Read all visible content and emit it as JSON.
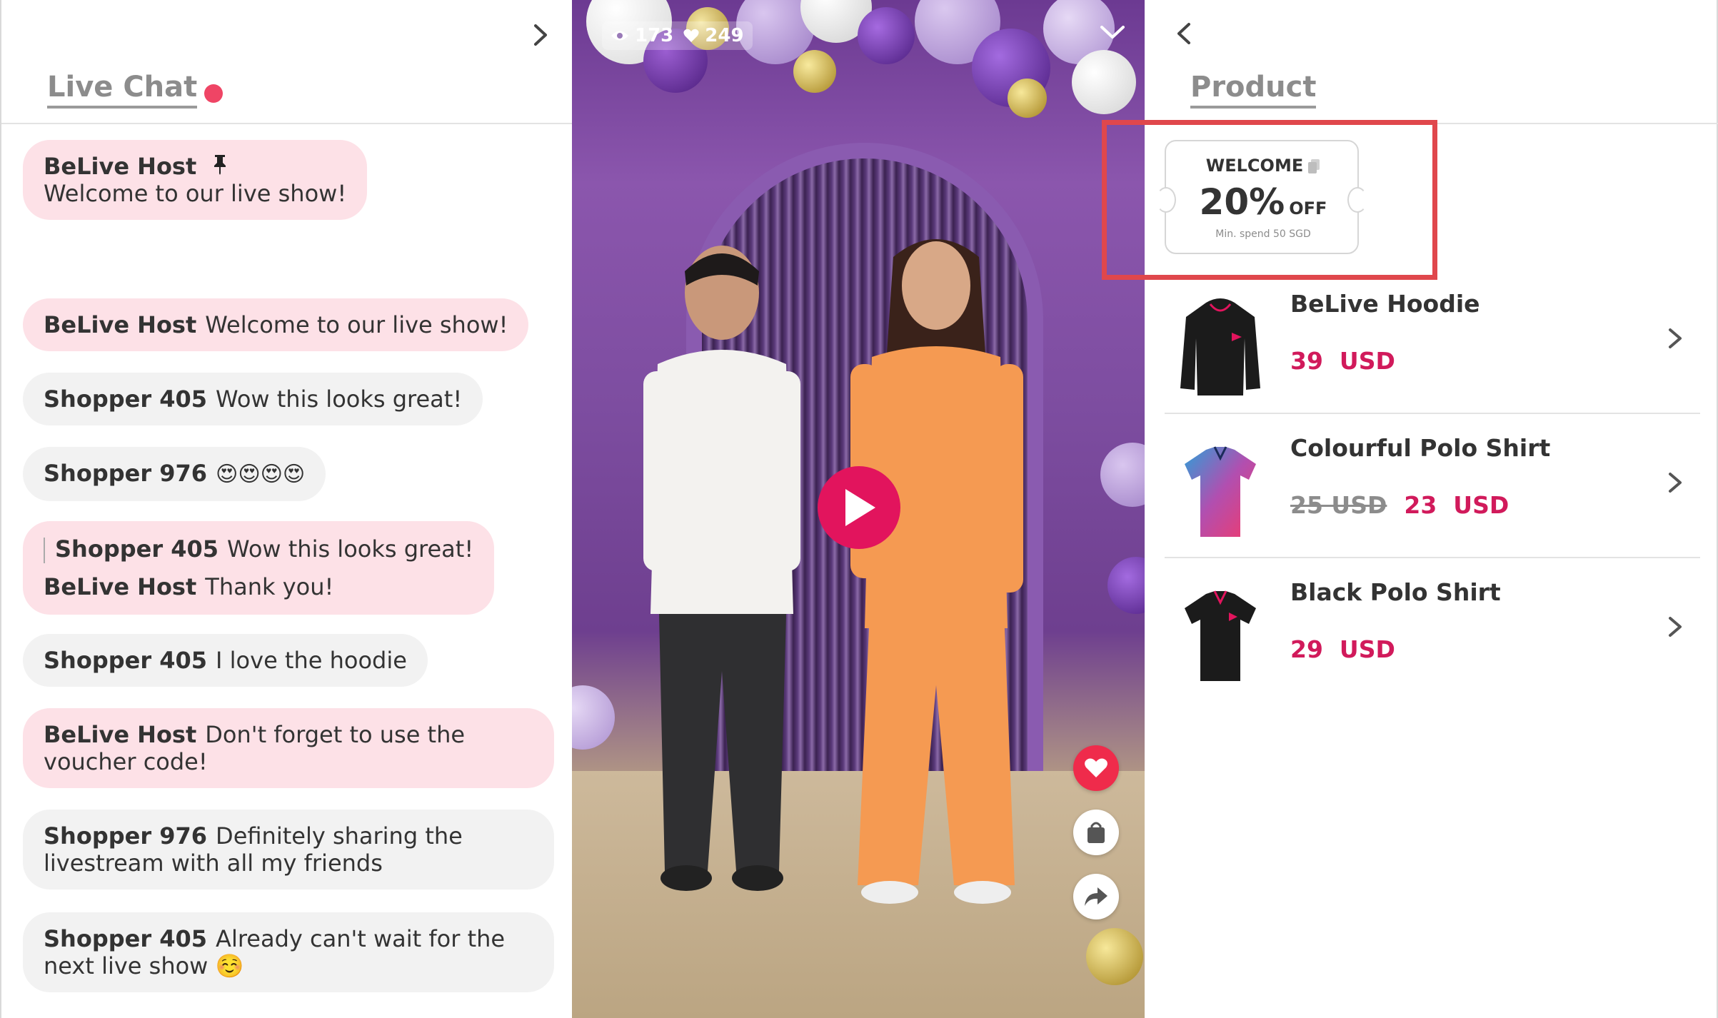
{
  "chat": {
    "title": "Live Chat",
    "pinned": {
      "name": "BeLive Host",
      "text": "Welcome to our live show!"
    },
    "messages": [
      {
        "name": "BeLive Host",
        "text": "Welcome to our live show!"
      },
      {
        "name": "Shopper 405",
        "text": "Wow this looks great!"
      },
      {
        "name": "Shopper 976",
        "text": "😍😍😍😍"
      },
      {
        "reply_name": "Shopper 405",
        "reply_text": "Wow this looks great!",
        "name": "BeLive Host",
        "text": "Thank you!"
      },
      {
        "name": "Shopper 405",
        "text": "I love the hoodie"
      },
      {
        "name": "BeLive Host",
        "text": "Don't forget to use the voucher code!"
      },
      {
        "name": "Shopper 976",
        "text": "Definitely sharing the livestream with all my friends"
      },
      {
        "name": "Shopper 405",
        "text": "Already can't wait for the next live show ☺️"
      }
    ]
  },
  "video": {
    "views": "173",
    "likes": "249"
  },
  "products": {
    "title": "Product",
    "voucher": {
      "label": "WELCOME",
      "percent": "20%",
      "off": "OFF",
      "min_spend": "Min. spend 50 SGD"
    },
    "items": [
      {
        "name": "BeLive Hoodie",
        "price": "39",
        "currency": "USD",
        "old_price": ""
      },
      {
        "name": "Colourful Polo Shirt",
        "price": "23",
        "currency": "USD",
        "old_price": "25 USD"
      },
      {
        "name": "Black Polo Shirt",
        "price": "29",
        "currency": "USD",
        "old_price": ""
      }
    ]
  },
  "colors": {
    "accent": "#e2145d",
    "price": "#d11a5b",
    "host_bubble": "#fde1e7",
    "shopper_bubble": "#f2f2f2",
    "highlight": "#e0474c"
  }
}
